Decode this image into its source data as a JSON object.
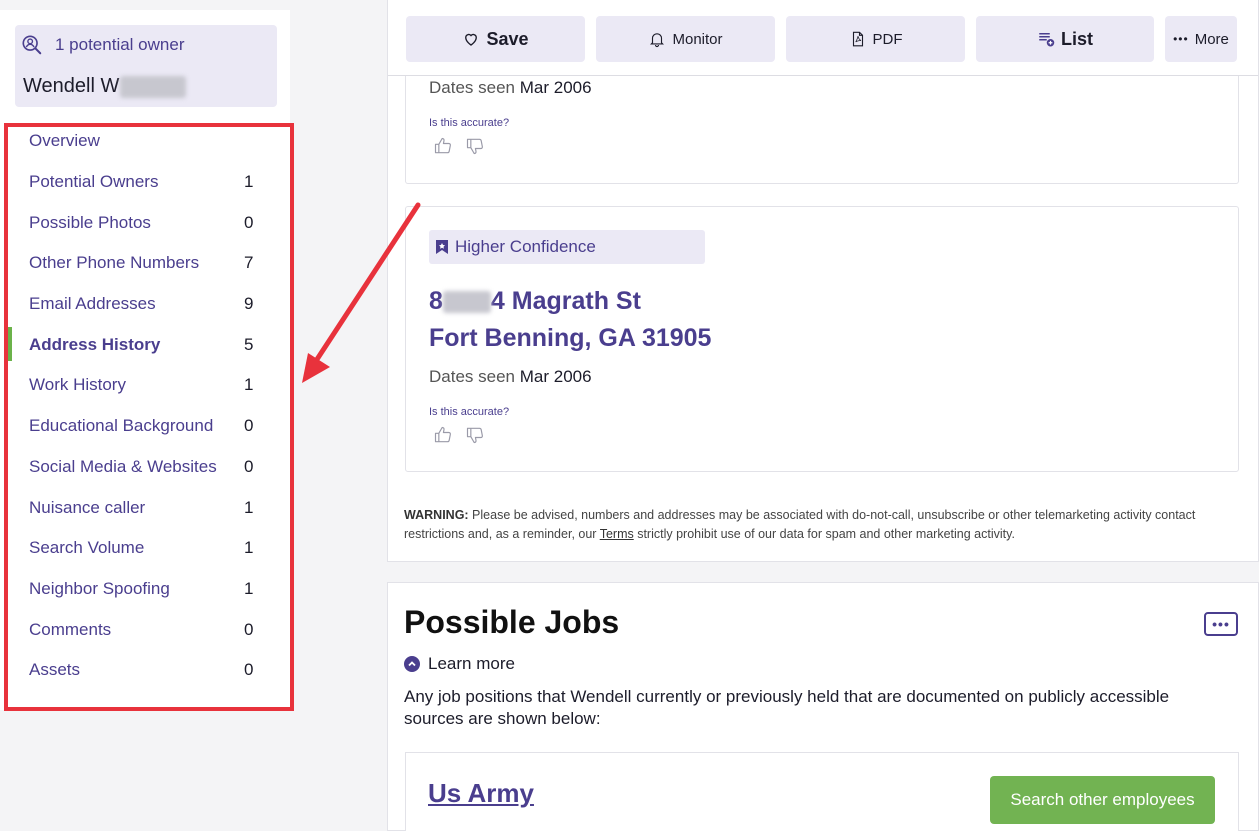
{
  "sidebar": {
    "owner_count_label": "1 potential owner",
    "owner_name_visible": "Wendell W",
    "items": [
      {
        "label": "Overview",
        "count": ""
      },
      {
        "label": "Potential Owners",
        "count": "1"
      },
      {
        "label": "Possible Photos",
        "count": "0"
      },
      {
        "label": "Other Phone Numbers",
        "count": "7"
      },
      {
        "label": "Email Addresses",
        "count": "9"
      },
      {
        "label": "Address History",
        "count": "5"
      },
      {
        "label": "Work History",
        "count": "1"
      },
      {
        "label": "Educational Background",
        "count": "0"
      },
      {
        "label": "Social Media & Websites",
        "count": "0"
      },
      {
        "label": "Nuisance caller",
        "count": "1"
      },
      {
        "label": "Search Volume",
        "count": "1"
      },
      {
        "label": "Neighbor Spoofing",
        "count": "1"
      },
      {
        "label": "Comments",
        "count": "0"
      },
      {
        "label": "Assets",
        "count": "0"
      }
    ],
    "active_item": "Address History"
  },
  "toolbar": {
    "save": "Save",
    "monitor": "Monitor",
    "pdf": "PDF",
    "list": "List",
    "more": "More"
  },
  "address_cards": [
    {
      "dates_label": "Dates seen",
      "dates_value": "Mar 2006",
      "accuracy_prompt": "Is this accurate?"
    },
    {
      "confidence": "Higher Confidence",
      "street_visible": "4 Magrath St",
      "street_prefix_visible": "8",
      "city_line": "Fort Benning, GA 31905",
      "dates_label": "Dates seen",
      "dates_value": "Mar 2006",
      "accuracy_prompt": "Is this accurate?"
    }
  ],
  "warning": {
    "label": "WARNING:",
    "text_before": " Please be advised, numbers and addresses may be associated with do-not-call, unsubscribe or other telemarketing activity contact restrictions and, as a reminder, our ",
    "link": "Terms",
    "text_after": " strictly prohibit use of our data for spam and other marketing activity."
  },
  "jobs": {
    "title": "Possible Jobs",
    "more_button": "•••",
    "learn_more": "Learn more",
    "description": "Any job positions that Wendell currently or previously held that are documented on publicly accessible sources are shown below:",
    "items": [
      {
        "name": "Us Army",
        "action": "Search other employees"
      }
    ]
  },
  "colors": {
    "brand_purple": "#4a3e8e",
    "badge_bg": "#ebe9f5",
    "active_bar": "#6bb24a",
    "annotation_red": "#e8323c",
    "button_green": "#72b352"
  }
}
